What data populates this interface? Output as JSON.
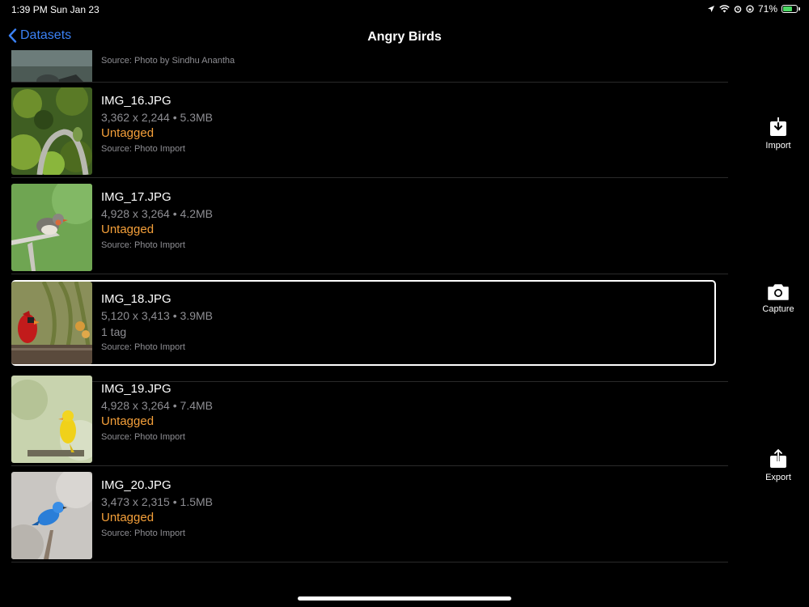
{
  "status_bar": {
    "time": "1:39 PM",
    "date": "Sun Jan 23",
    "battery": "71%",
    "battery_level": 0.71
  },
  "nav": {
    "back_label": "Datasets",
    "title": "Angry Birds"
  },
  "partial_row": {
    "source": "Source: Photo by Sindhu Anantha"
  },
  "rows": [
    {
      "filename": "IMG_16.JPG",
      "dims": "3,362 x 2,244 • 5.3MB",
      "tag": "Untagged",
      "source": "Source: Photo Import",
      "thumb": "bird-on-branch"
    },
    {
      "filename": "IMG_17.JPG",
      "dims": "4,928 x 3,264 • 4.2MB",
      "tag": "Untagged",
      "source": "Source: Photo Import",
      "thumb": "finch"
    },
    {
      "filename": "IMG_18.JPG",
      "dims": "5,120 x 3,413 • 3.9MB",
      "tag": "1 tag",
      "source": "Source: Photo Import",
      "thumb": "cardinal",
      "selected": true
    },
    {
      "filename": "IMG_19.JPG",
      "dims": "4,928 x 3,264 • 7.4MB",
      "tag": "Untagged",
      "source": "Source: Photo Import",
      "thumb": "canary"
    },
    {
      "filename": "IMG_20.JPG",
      "dims": "3,473 x 2,315 • 1.5MB",
      "tag": "Untagged",
      "source": "Source: Photo Import",
      "thumb": "bluebird"
    }
  ],
  "side_actions": {
    "import": {
      "label": "Import",
      "icon": "import-icon"
    },
    "capture": {
      "label": "Capture",
      "icon": "camera-icon"
    },
    "export": {
      "label": "Export",
      "icon": "share-icon"
    }
  },
  "colors": {
    "accent": "#3b82f6",
    "untagged": "#f5a03a",
    "secondary": "#8e8e93"
  }
}
